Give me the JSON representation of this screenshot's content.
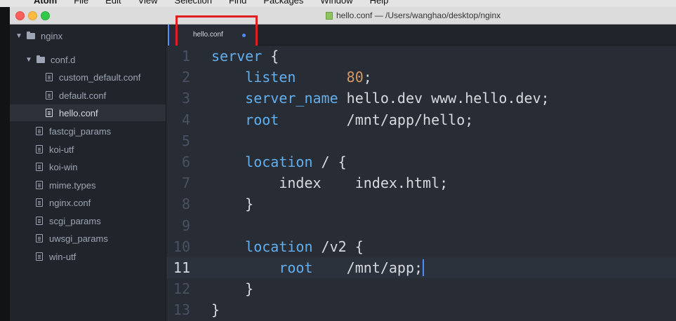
{
  "menubar": {
    "apple": "",
    "app_name": "Atom",
    "items": [
      "File",
      "Edit",
      "View",
      "Selection",
      "Find",
      "Packages",
      "Window",
      "Help"
    ]
  },
  "window": {
    "title": "hello.conf — /Users/wanghao/desktop/nginx"
  },
  "tree": {
    "root": "nginx",
    "subfolder": "conf.d",
    "subfolder_files": [
      "custom_default.conf",
      "default.conf",
      "hello.conf"
    ],
    "files": [
      "fastcgi_params",
      "koi-utf",
      "koi-win",
      "mime.types",
      "nginx.conf",
      "scgi_params",
      "uwsgi_params",
      "win-utf"
    ],
    "selected": "hello.conf"
  },
  "tab": {
    "label": "hello.conf",
    "modified": true
  },
  "editor": {
    "cursor_line": 11,
    "lines": [
      {
        "n": "1",
        "parts": [
          [
            "kw",
            "server"
          ],
          [
            "txt",
            " {"
          ]
        ]
      },
      {
        "n": "2",
        "parts": [
          [
            "txt",
            "    "
          ],
          [
            "kw",
            "listen"
          ],
          [
            "txt",
            "      "
          ],
          [
            "num",
            "80"
          ],
          [
            "txt",
            ";"
          ]
        ]
      },
      {
        "n": "3",
        "parts": [
          [
            "txt",
            "    "
          ],
          [
            "kw",
            "server_name"
          ],
          [
            "txt",
            " hello.dev www.hello.dev;"
          ]
        ]
      },
      {
        "n": "4",
        "parts": [
          [
            "txt",
            "    "
          ],
          [
            "kw",
            "root"
          ],
          [
            "txt",
            "        /mnt/app/hello;"
          ]
        ]
      },
      {
        "n": "5",
        "parts": []
      },
      {
        "n": "6",
        "parts": [
          [
            "txt",
            "    "
          ],
          [
            "kw",
            "location"
          ],
          [
            "txt",
            " / {"
          ]
        ]
      },
      {
        "n": "7",
        "parts": [
          [
            "txt",
            "        "
          ],
          [
            "txt",
            "index    index.html;"
          ]
        ]
      },
      {
        "n": "8",
        "parts": [
          [
            "txt",
            "    }"
          ]
        ]
      },
      {
        "n": "9",
        "parts": []
      },
      {
        "n": "10",
        "parts": [
          [
            "txt",
            "    "
          ],
          [
            "kw",
            "location"
          ],
          [
            "txt",
            " /v2 {"
          ]
        ]
      },
      {
        "n": "11",
        "parts": [
          [
            "txt",
            "        "
          ],
          [
            "kw",
            "root"
          ],
          [
            "txt",
            "    /mnt/app;"
          ]
        ]
      },
      {
        "n": "12",
        "parts": [
          [
            "txt",
            "    }"
          ]
        ]
      },
      {
        "n": "13",
        "parts": [
          [
            "txt",
            "}"
          ]
        ]
      }
    ]
  },
  "colors": {
    "keyword": "#61afef",
    "number": "#d19a66",
    "text": "#d7dae0",
    "accent": "#528bff",
    "highlight_box": "#e02020"
  }
}
